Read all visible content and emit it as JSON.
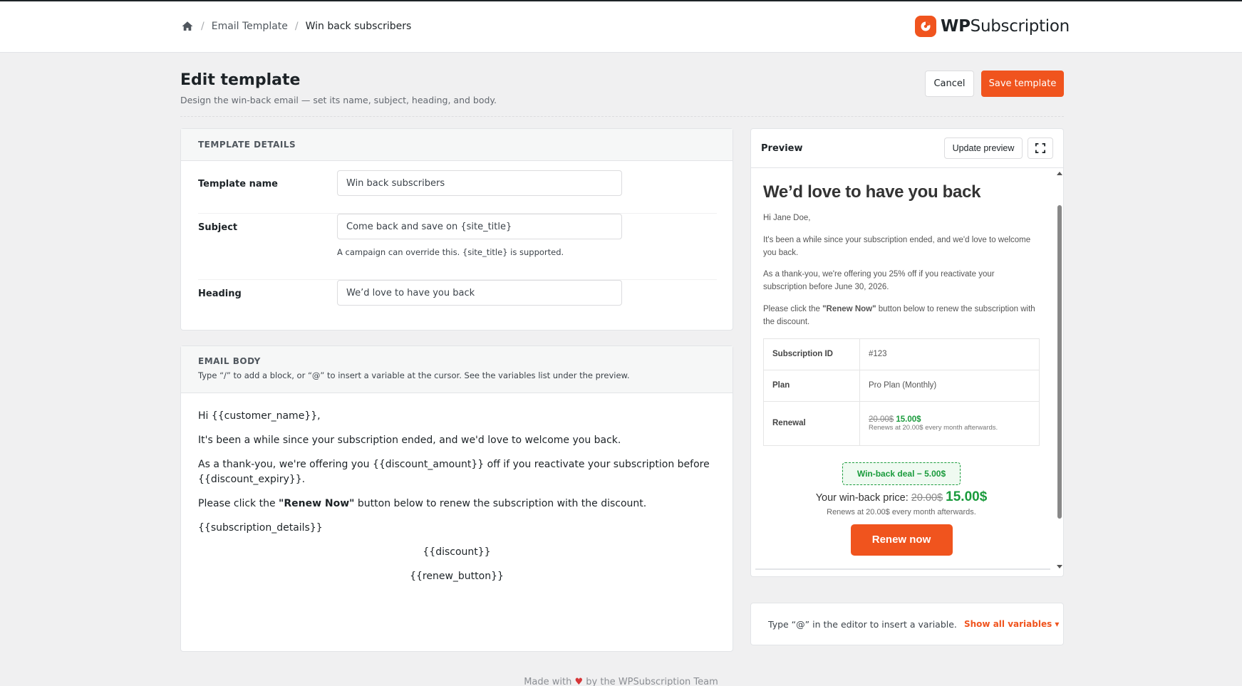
{
  "breadcrumb": {
    "home_icon": "home-icon",
    "items": [
      "Email Template",
      "Win back subscribers"
    ]
  },
  "brand": {
    "name_bold": "WP",
    "name_rest": "Subscription",
    "color": "#f0541e"
  },
  "page": {
    "title": "Edit template",
    "subtitle": "Design the win-back email — set its name, subject, heading, and body.",
    "cancel_label": "Cancel",
    "save_label": "Save template"
  },
  "details": {
    "section_title": "TEMPLATE DETAILS",
    "name_label": "Template name",
    "name_value": "Win back subscribers",
    "subject_label": "Subject",
    "subject_value": "Come back and save on {site_title}",
    "subject_help": "A campaign can override this. {site_title} is supported.",
    "heading_label": "Heading",
    "heading_value": "We’d love to have you back"
  },
  "body": {
    "section_title": "EMAIL BODY",
    "description": "Type “/” to add a block, or “@” to insert a variable at the cursor. See the variables list under the preview.",
    "line1": "Hi {{customer_name}},",
    "line2": "It's been a while since your subscription ended, and we'd love to welcome you back.",
    "line3": "As a thank-you, we're offering you {{discount_amount}} off if you reactivate your subscription before {{discount_expiry}}.",
    "line4_pre": "Please click the ",
    "line4_bold": "\"Renew Now\"",
    "line4_post": " button below to renew the subscription with the discount.",
    "line5": "{{subscription_details}}",
    "line6": "{{discount}}",
    "line7": "{{renew_button}}"
  },
  "preview": {
    "title": "Preview",
    "update_label": "Update preview",
    "expand_icon": "expand-icon",
    "heading": "We’d love to have you back",
    "greeting": "Hi Jane Doe,",
    "p1": "It's been a while since your subscription ended, and we'd love to welcome you back.",
    "p2": "As a thank-you, we're offering you 25% off if you reactivate your subscription before June 30, 2026.",
    "p3_pre": "Please click the ",
    "p3_bold": "\"Renew Now\"",
    "p3_post": " button below to renew the subscription with the discount.",
    "table": [
      {
        "key": "Subscription ID",
        "value": "#123"
      },
      {
        "key": "Plan",
        "value": "Pro Plan (Monthly)"
      }
    ],
    "renewal_key": "Renewal",
    "renewal_old": "20.00$",
    "renewal_new": "15.00$",
    "renewal_note": "Renews at 20.00$ every month afterwards.",
    "deal_badge": "Win-back deal − 5.00$",
    "price_label": "Your win-back price: ",
    "price_old": "20.00$",
    "price_new": "15.00$",
    "price_note": "Renews at 20.00$ every month afterwards.",
    "renew_button": "Renew now"
  },
  "variables": {
    "hint": "Type “@” in the editor to insert a variable.",
    "link": "Show all variables ▾"
  },
  "footer": {
    "pre": "Made with ",
    "post": " by the WPSubscription Team"
  }
}
